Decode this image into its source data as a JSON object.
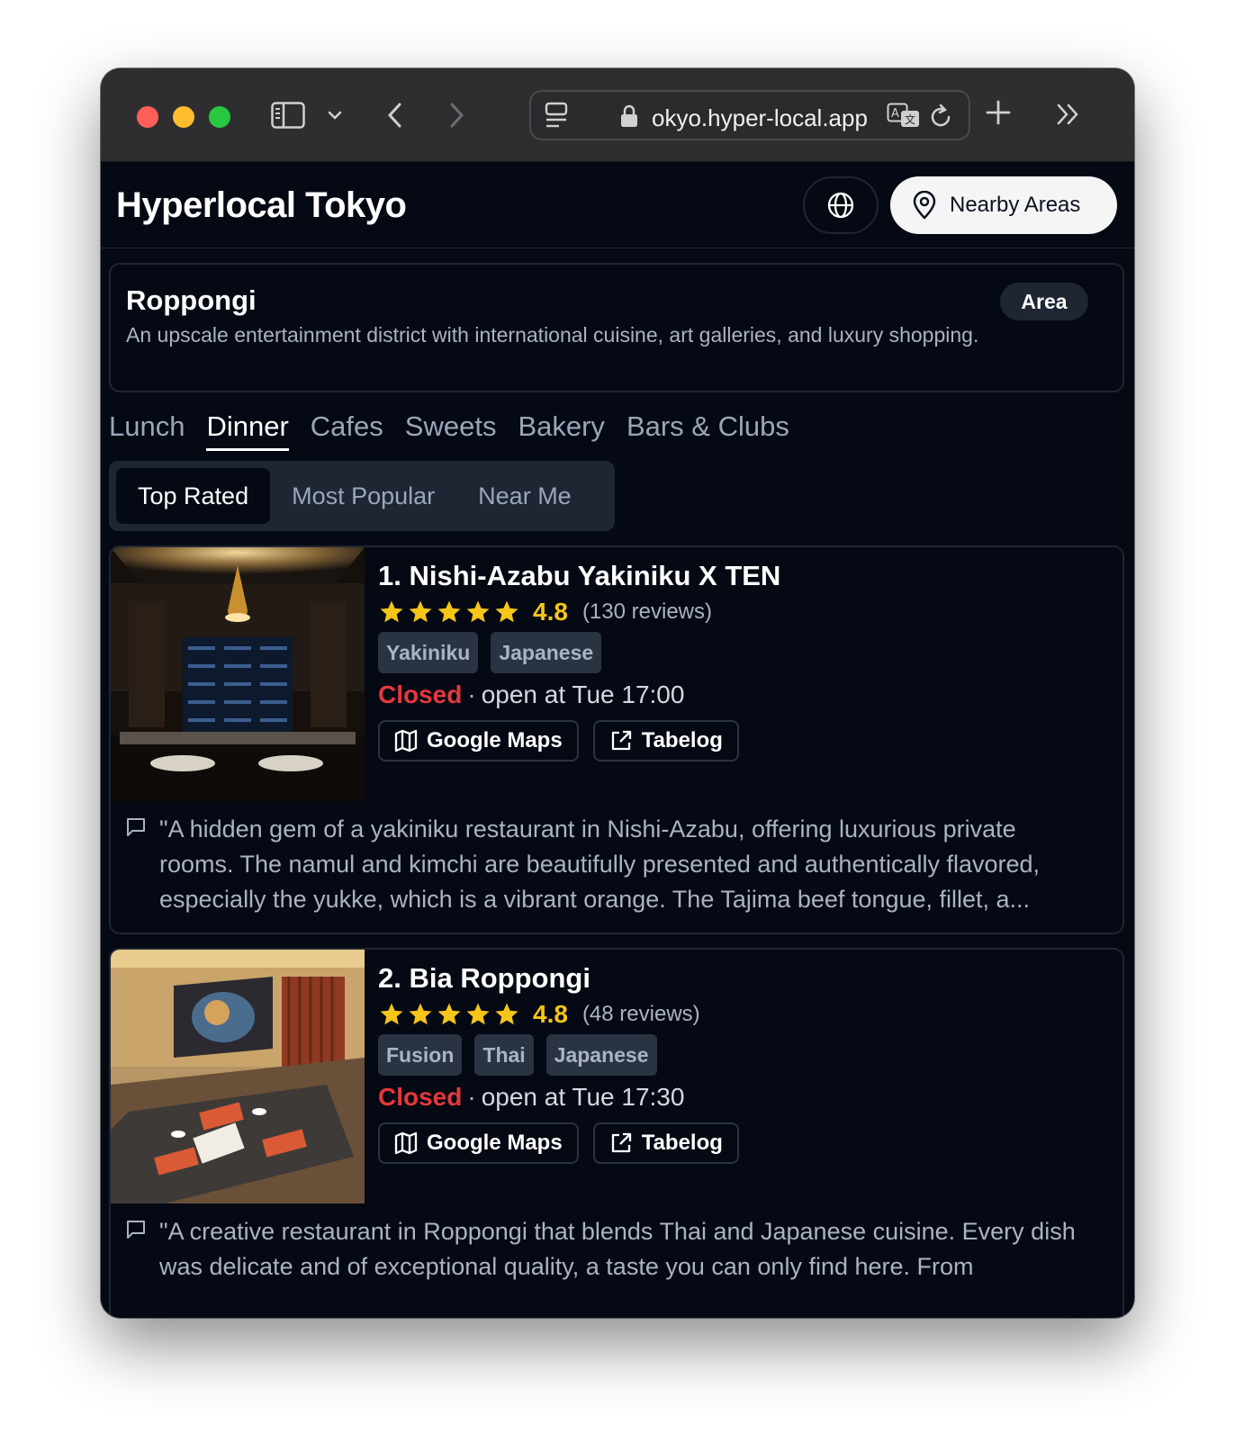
{
  "browser": {
    "url_display": "okyo.hyper-local.app"
  },
  "app": {
    "title": "Hyperlocal Tokyo",
    "nearby_label": "Nearby Areas"
  },
  "area": {
    "name": "Roppongi",
    "description": "An upscale entertainment district with international cuisine, art galleries, and luxury shopping.",
    "badge": "Area"
  },
  "categories": [
    "Lunch",
    "Dinner",
    "Cafes",
    "Sweets",
    "Bakery",
    "Bars & Clubs"
  ],
  "active_category": "Dinner",
  "sort_options": [
    "Top Rated",
    "Most Popular",
    "Near Me"
  ],
  "active_sort": "Top Rated",
  "colors": {
    "accent_star": "#f5c518",
    "closed": "#e5383b",
    "background": "#050914"
  },
  "restaurants": [
    {
      "name": "1. Nishi-Azabu Yakiniku X TEN",
      "rating": "4.8",
      "stars": 5,
      "reviews": "(130 reviews)",
      "tags": [
        "Yakiniku",
        "Japanese"
      ],
      "status": "Closed",
      "separator": "·",
      "next_open": "open at Tue 17:00",
      "maps_label": "Google Maps",
      "tabelog_label": "Tabelog",
      "review": "\"A hidden gem of a yakiniku restaurant in Nishi-Azabu, offering luxurious private rooms. The namul and kimchi are beautifully presented and authentically flavored, especially the yukke, which is a vibrant orange. The Tajima beef tongue, fillet, a..."
    },
    {
      "name": "2. Bia Roppongi",
      "rating": "4.8",
      "stars": 5,
      "reviews": "(48 reviews)",
      "tags": [
        "Fusion",
        "Thai",
        "Japanese"
      ],
      "status": "Closed",
      "separator": "·",
      "next_open": "open at Tue 17:30",
      "maps_label": "Google Maps",
      "tabelog_label": "Tabelog",
      "review": "\"A creative restaurant in Roppongi that blends Thai and Japanese cuisine. Every dish was delicate and of exceptional quality, a taste you can only find here. From"
    }
  ]
}
